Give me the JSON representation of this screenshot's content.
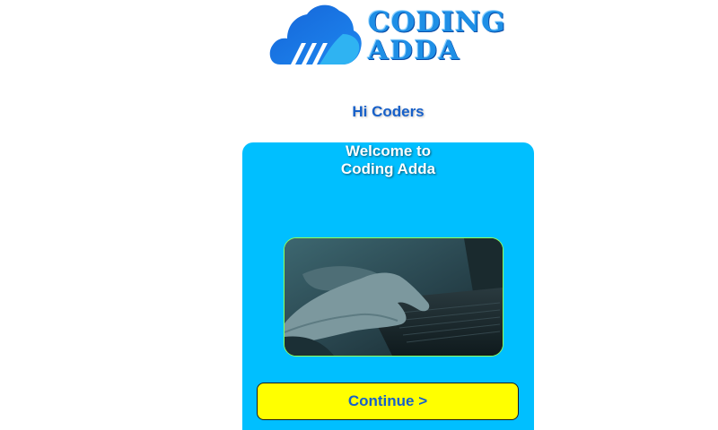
{
  "logo": {
    "line1": "CODING",
    "line2": "ADDA",
    "icon": "cloud-icon",
    "color": "#1e8fe6"
  },
  "greeting": "Hi Coders",
  "card": {
    "welcome_line1": "Welcome to",
    "welcome_line2": "Coding Adda",
    "background": "#00bfff",
    "image": "typing-on-laptop-photo",
    "continue_label": "Continue >",
    "button_color": "#ffff00"
  }
}
